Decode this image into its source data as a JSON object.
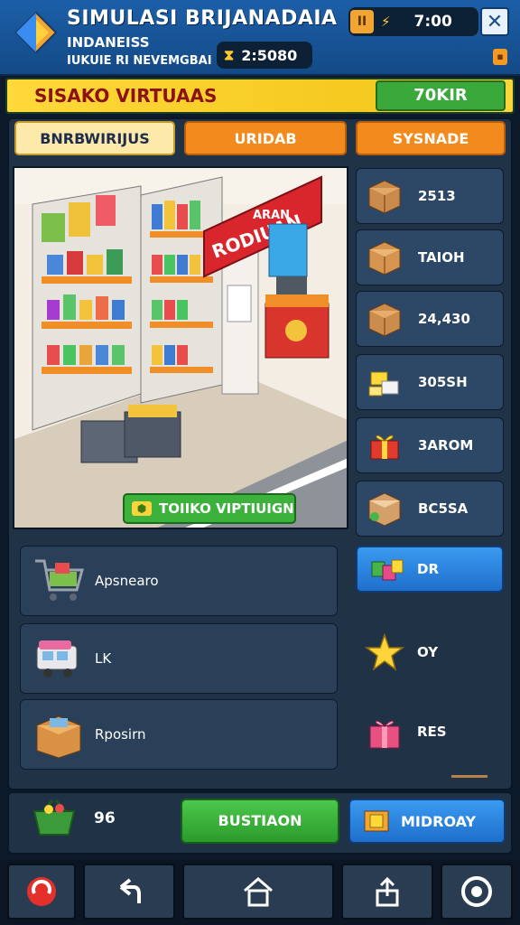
{
  "header": {
    "title": "SIMULASI BRIJANADAIA",
    "subtitle": "INDANEISS",
    "subtitle2": "IUKUIE RI NEVEMGBAI",
    "timer": "2:5080",
    "clock": "7:00",
    "pause_glyph": "II"
  },
  "banner": {
    "title": "SISAKO VIRTUAAS",
    "value": "70KIR"
  },
  "tabs": [
    {
      "label": "BNRBWIRIJUS"
    },
    {
      "label": "URIDAB"
    },
    {
      "label": "SYSNADE"
    }
  ],
  "scene": {
    "sign_top": "ARAN",
    "sign": "RODIUAN",
    "button": "TOIIKO VIPTIUIGN"
  },
  "inventory": [
    {
      "icon": "box-icon",
      "value": "2513"
    },
    {
      "icon": "box-icon",
      "value": "TAIOH"
    },
    {
      "icon": "box-icon",
      "value": "24,430"
    },
    {
      "icon": "cheese-icon",
      "value": "305SH"
    },
    {
      "icon": "gift-icon",
      "value": "3AROM"
    },
    {
      "icon": "box-icon",
      "value": "BC5SA"
    },
    {
      "icon": "gift-icon",
      "value": "DR"
    },
    {
      "icon": "star-icon",
      "value": "OY"
    },
    {
      "icon": "gift-icon",
      "value": "RES"
    }
  ],
  "list": [
    {
      "icon": "cart-icon",
      "label": "Apsnearo"
    },
    {
      "icon": "van-icon",
      "label": "LK"
    },
    {
      "icon": "box-icon",
      "label": "Rposirn"
    }
  ],
  "footer": {
    "count": "96",
    "green_button": "BUSTIAON",
    "blue_button": "MIDROAY"
  },
  "colors": {
    "accent_yellow": "#ffd83a",
    "accent_green": "#3cb23c",
    "accent_blue": "#2a86e4",
    "accent_orange": "#f38a1e",
    "panel": "#1f3246"
  }
}
